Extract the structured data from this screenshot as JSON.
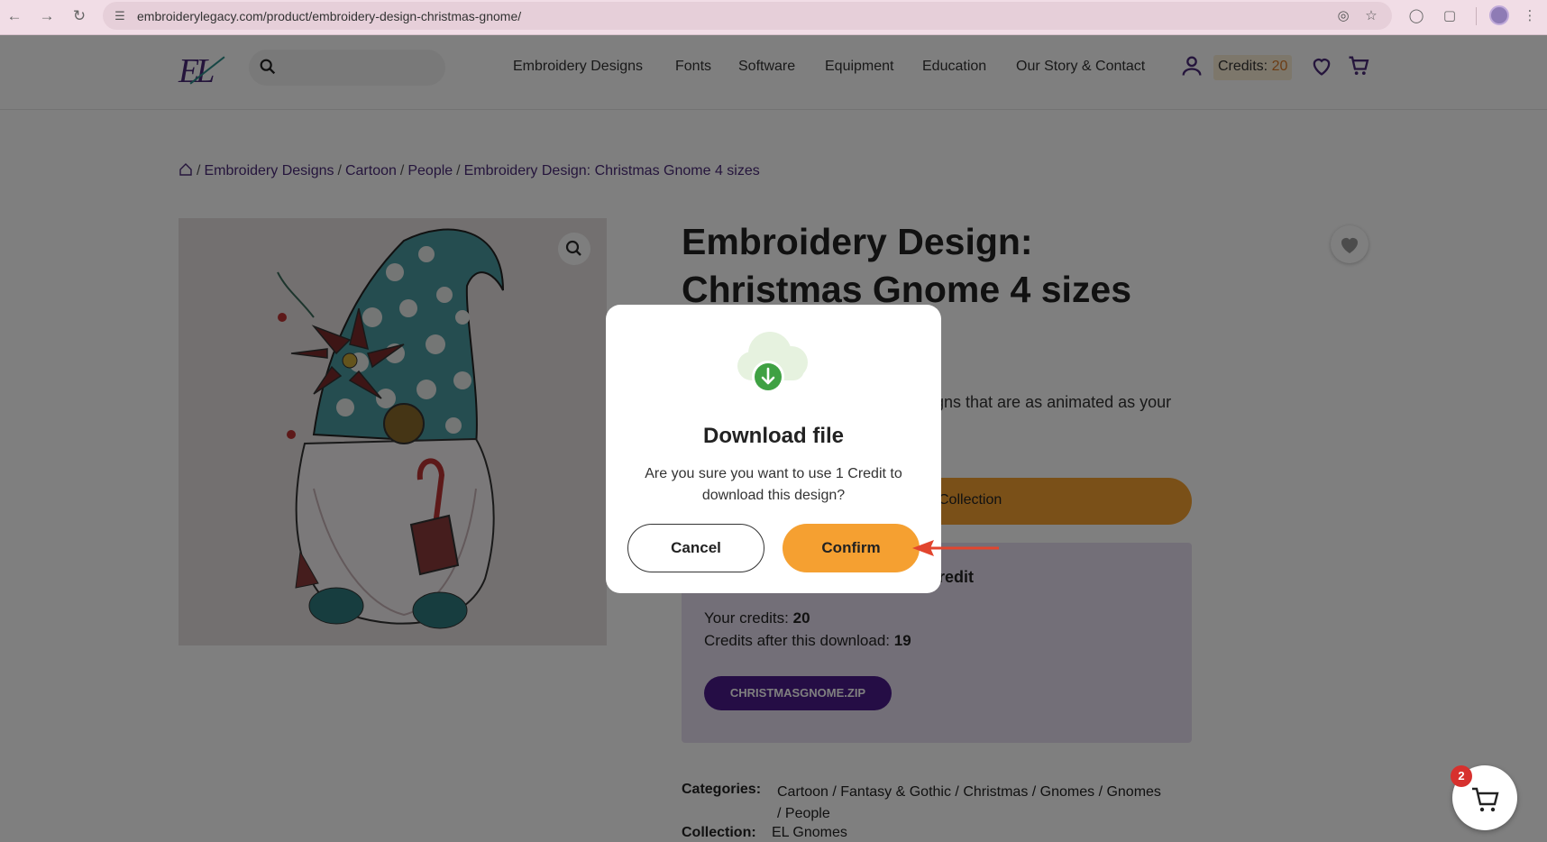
{
  "browser": {
    "url": "embroiderylegacy.com/product/embroidery-design-christmas-gnome/"
  },
  "header": {
    "logo": "EL",
    "nav": [
      "Embroidery Designs",
      "Fonts",
      "Software",
      "Equipment",
      "Education",
      "Our Story & Contact"
    ],
    "credits_label": "Credits:",
    "credits_value": "20"
  },
  "breadcrumb": [
    "Embroidery Designs",
    "Cartoon",
    "People",
    "Embroidery Design: Christmas Gnome 4 sizes"
  ],
  "product": {
    "title_line1": "Embroidery Design:",
    "title_line2": "Christmas Gnome 4 sizes",
    "desc_fragment": "gns that are as animated as your",
    "collection_btn_fragment": "Collection",
    "credit_heading_fragment": "redit",
    "your_credits_label": "Your credits:",
    "your_credits_value": "20",
    "after_label": "Credits after this download:",
    "after_value": "19",
    "zip_button": "CHRISTMASGNOME.ZIP",
    "categories_label": "Categories:",
    "categories_line1": "Cartoon / Fantasy & Gothic / Christmas / Gnomes / Gnomes",
    "categories_line2": "/ People",
    "collection_label": "Collection:",
    "collection_value": "EL Gnomes"
  },
  "modal": {
    "title": "Download file",
    "message": "Are you sure you want to use 1 Credit to download this design?",
    "cancel": "Cancel",
    "confirm": "Confirm"
  },
  "cart": {
    "badge": "2"
  },
  "colors": {
    "brand": "#4b2b79",
    "accent": "#f5a031",
    "badge": "#d7312e"
  }
}
